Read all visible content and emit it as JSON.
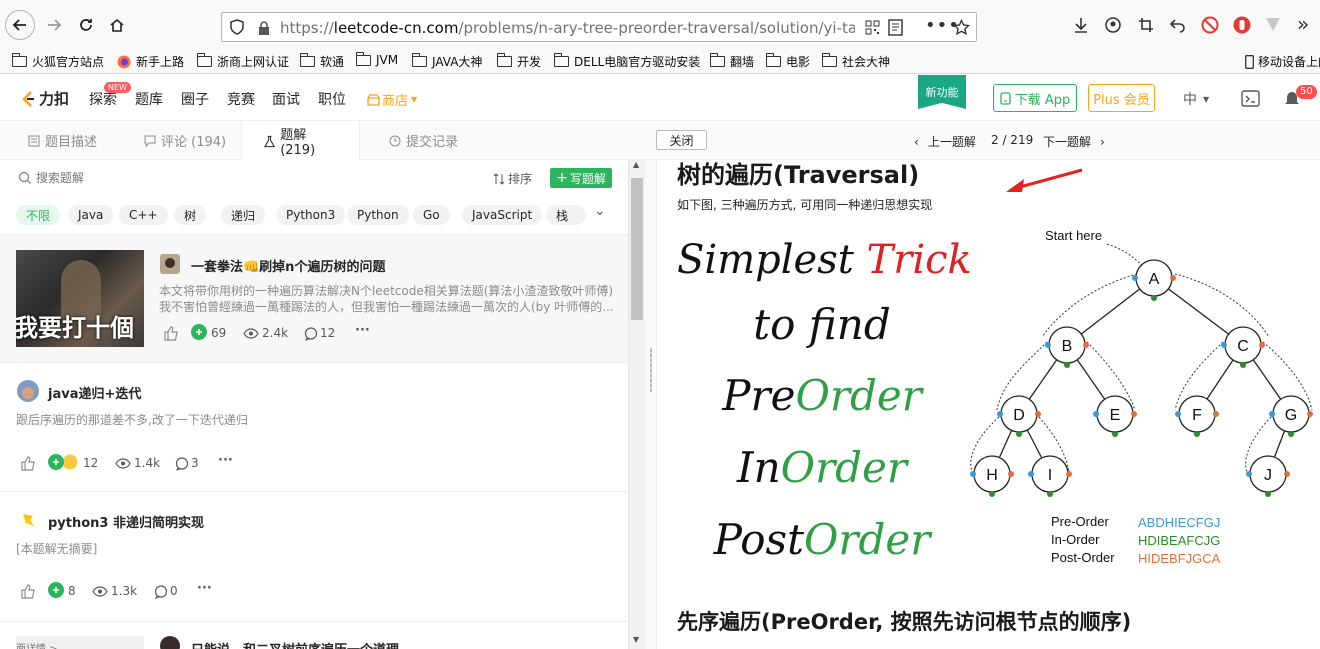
{
  "browser": {
    "url_prefix": "https://",
    "url_domain": "leetcode-cn.com",
    "url_path": "/problems/n-ary-tree-preorder-traversal/solution/yi-tao-quan-f",
    "bookmarks": [
      "火狐官方站点",
      "新手上路",
      "浙商上网认证",
      "软通",
      "JVM",
      "JAVA大神",
      "开发",
      "DELL电脑官方驱动安装",
      "翻墙",
      "电影",
      "社会大神"
    ],
    "mobile_bookmarks": "移动设备上的"
  },
  "site": {
    "logo_text": "力扣",
    "nav": [
      "探索",
      "题库",
      "圈子",
      "竞赛",
      "面试",
      "职位"
    ],
    "new_badge": "NEW",
    "store": "商店",
    "new_feature": "新功能",
    "download_app": "下载 App",
    "plus": "Plus 会员",
    "lang": "中",
    "notif_count": "50"
  },
  "tabs": {
    "items": [
      "题目描述",
      "评论 (194)",
      "题解(219)",
      "提交记录"
    ],
    "close": "关闭",
    "prev": "上一题解",
    "page": "2 / 219",
    "next": "下一题解"
  },
  "left": {
    "search_placeholder": "搜索题解",
    "sort": "排序",
    "write": "写题解",
    "chips": [
      "不限",
      "Java",
      "C++",
      "树",
      "递归",
      "Python3",
      "Python",
      "Go",
      "JavaScript",
      "栈"
    ],
    "solutions": [
      {
        "title": "一套拳法👊刷掉n个遍历树的问题",
        "thumb_text": "我要打十個",
        "desc1": "本文将带你用树的一种遍历算法解决N个leetcode相关算法题(算法小渣渣致敬叶师傅)",
        "desc2": "我不害怕曾經練過一萬種踢法的人，但我害怕一種踢法練過一萬次的人(by 叶师傅的...",
        "likes": "69",
        "views": "2.4k",
        "comments": "12"
      },
      {
        "title": "java递归+迭代",
        "desc1": "跟后序遍历的那道差不多,改了一下迭代递归",
        "likes": "12",
        "views": "1.4k",
        "comments": "3"
      },
      {
        "title": "python3 非递归简明实现",
        "desc1": "[本题解无摘要]",
        "likes": "8",
        "views": "1.3k",
        "comments": "0"
      },
      {
        "title": "只能说，和二叉树前序遍历一个道理",
        "thumb_text": "面详情 >"
      }
    ]
  },
  "right": {
    "heading": "树的遍历(Traversal)",
    "subtext": "如下图, 三种遍历方式, 可用同一种递归思想实现",
    "trick": {
      "line1a": "Simplest ",
      "line1b": "Trick",
      "line2": "to find",
      "pre_a": "Pre",
      "pre_b": "Order",
      "in_a": "In",
      "in_b": "Order",
      "post_a": "Post",
      "post_b": "Order"
    },
    "tree": {
      "start": "Start here",
      "nodes": [
        "A",
        "B",
        "C",
        "D",
        "E",
        "F",
        "G",
        "H",
        "I",
        "J"
      ],
      "orders": [
        {
          "label": "Pre-Order",
          "value": "ABDHIECFGJ",
          "color": "#3a9ad9"
        },
        {
          "label": "In-Order",
          "value": "HDIBEAFCJG",
          "color": "#2e8b2e"
        },
        {
          "label": "Post-Order",
          "value": "HIDEBFJGCA",
          "color": "#e0703a"
        }
      ]
    },
    "heading2": "先序遍历(PreOrder, 按照先访问根节点的顺序)"
  },
  "colors": {
    "accent": "#2db55d",
    "link": "#007aff",
    "red": "#e53935",
    "orange": "#ffa116"
  }
}
